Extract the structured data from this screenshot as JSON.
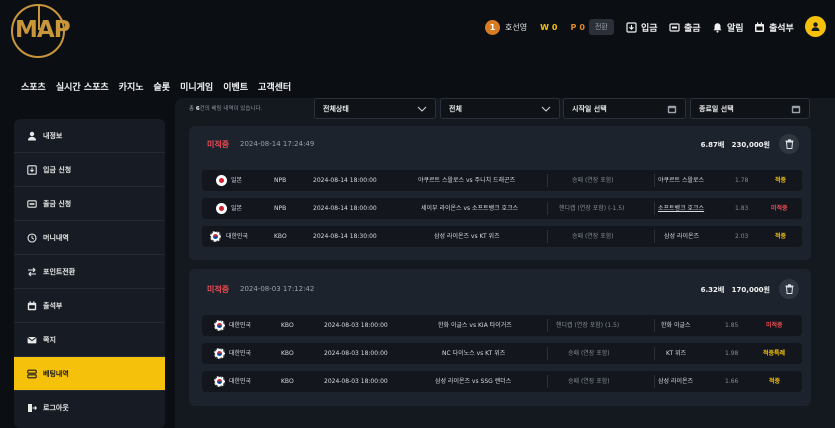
{
  "header": {
    "logo_text": "MAP",
    "user": {
      "level": "1",
      "name": "호선영",
      "won_label": "W",
      "won_value": "0",
      "point_label": "P",
      "point_value": "0",
      "convert_label": "전환"
    },
    "actions": [
      {
        "label": "입금",
        "icon": "deposit-icon"
      },
      {
        "label": "출금",
        "icon": "withdraw-icon"
      },
      {
        "label": "알림",
        "icon": "bell-icon"
      },
      {
        "label": "출석부",
        "icon": "calendar-icon"
      }
    ]
  },
  "nav": [
    "스포츠",
    "실시간 스포츠",
    "카지노",
    "슬롯",
    "미니게임",
    "이벤트",
    "고객센터"
  ],
  "sidebar": [
    {
      "label": "내정보",
      "icon": "user-icon"
    },
    {
      "label": "입금 신청",
      "icon": "deposit-icon"
    },
    {
      "label": "출금 신청",
      "icon": "withdraw-icon"
    },
    {
      "label": "머니내역",
      "icon": "clock-icon"
    },
    {
      "label": "포인트전환",
      "icon": "swap-icon"
    },
    {
      "label": "출석부",
      "icon": "calendar-icon"
    },
    {
      "label": "쪽지",
      "icon": "mail-icon"
    },
    {
      "label": "베팅내역",
      "icon": "list-icon"
    },
    {
      "label": "로그아웃",
      "icon": "logout-icon"
    }
  ],
  "filters": {
    "note_prefix": "총 ",
    "note_count": "6",
    "note_suffix": "건의 베팅 내역이 있습니다.",
    "status_select": "전체상태",
    "type_select": "전체",
    "start_date": "시작일 선택",
    "end_date": "종료일 선택"
  },
  "bets": [
    {
      "status": "미적중",
      "date": "2024-08-14 17:24:49",
      "total_odds": "6.87배",
      "amount": "230,000원",
      "rows": [
        {
          "country": "일본",
          "flag": "jp",
          "league": "NPB",
          "time": "2024-08-14 18:00:00",
          "match": "야쿠르트 스왈로스 vs 주니치 드래곤즈",
          "market": "승패 (연장 포함)",
          "pick": "야쿠르트 스왈로스",
          "odds": "1.78",
          "result": "적중",
          "result_type": "yellow",
          "underline": false
        },
        {
          "country": "일본",
          "flag": "jp",
          "league": "NPB",
          "time": "2024-08-14 18:00:00",
          "match": "세이부 라이온스 vs 소프트뱅크 호크스",
          "market": "핸디캡 (연장 포함) (-1.5)",
          "pick": "소프트뱅크 호크스",
          "odds": "1.83",
          "result": "미적중",
          "result_type": "red",
          "underline": true
        },
        {
          "country": "대한민국",
          "flag": "kr",
          "league": "KBO",
          "time": "2024-08-14 18:30:00",
          "match": "삼성 라이온즈 vs KT 위즈",
          "market": "승패 (연장 포함)",
          "pick": "삼성 라이온즈",
          "odds": "2.03",
          "result": "적중",
          "result_type": "yellow",
          "underline": false
        }
      ]
    },
    {
      "status": "미적중",
      "date": "2024-08-03 17:12:42",
      "total_odds": "6.32배",
      "amount": "170,000원",
      "rows": [
        {
          "country": "대한민국",
          "flag": "kr",
          "league": "KBO",
          "time": "2024-08-03 18:00:00",
          "match": "한화 이글스 vs KIA 타이거즈",
          "market": "핸디캡 (연장 포함) (1.5)",
          "pick": "한화 이글스",
          "odds": "1.85",
          "result": "미적중",
          "result_type": "red",
          "underline": false
        },
        {
          "country": "대한민국",
          "flag": "kr",
          "league": "KBO",
          "time": "2024-08-03 18:00:00",
          "match": "NC 다이노스 vs KT 위즈",
          "market": "승패 (연장 포함)",
          "pick": "KT 위즈",
          "odds": "1.98",
          "result": "적중특례",
          "result_type": "yellow",
          "underline": false
        },
        {
          "country": "대한민국",
          "flag": "kr",
          "league": "KBO",
          "time": "2024-08-03 18:00:00",
          "match": "삼성 라이온즈 vs SSG 랜더스",
          "market": "승패 (연장 포함)",
          "pick": "삼성 라이온즈",
          "odds": "1.66",
          "result": "적중",
          "result_type": "yellow",
          "underline": false
        }
      ]
    }
  ],
  "colors": {
    "accent": "#f5c10b",
    "loss": "#ef4b53",
    "logo": "#c9973a"
  }
}
